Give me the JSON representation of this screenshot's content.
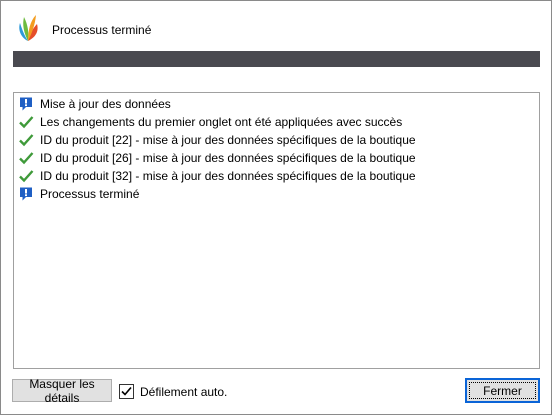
{
  "dialog": {
    "title": "Processus terminé",
    "progress_fraction": 1.0,
    "progress_color": "#4a4a50"
  },
  "log": {
    "items": [
      {
        "icon": "info-icon",
        "text": "Mise à jour des données"
      },
      {
        "icon": "checkmark-icon",
        "text": "Les changements du premier onglet ont été appliquées avec succès"
      },
      {
        "icon": "checkmark-icon",
        "text": "ID du produit [22] - mise à jour des données spécifiques de la boutique"
      },
      {
        "icon": "checkmark-icon",
        "text": "ID du produit [26] - mise à jour des données spécifiques de la boutique"
      },
      {
        "icon": "checkmark-icon",
        "text": "ID du produit [32] - mise à jour des données spécifiques de la boutique"
      },
      {
        "icon": "info-icon",
        "text": "Processus terminé"
      }
    ]
  },
  "footer": {
    "details_label": "Masquer les détails",
    "autoscroll_label": "Défilement auto.",
    "autoscroll_checked": true,
    "close_label": "Fermer"
  },
  "colors": {
    "check_green": "#3f9a3a",
    "info_blue": "#1f5fc4",
    "accent_blue": "#0a64d7"
  }
}
